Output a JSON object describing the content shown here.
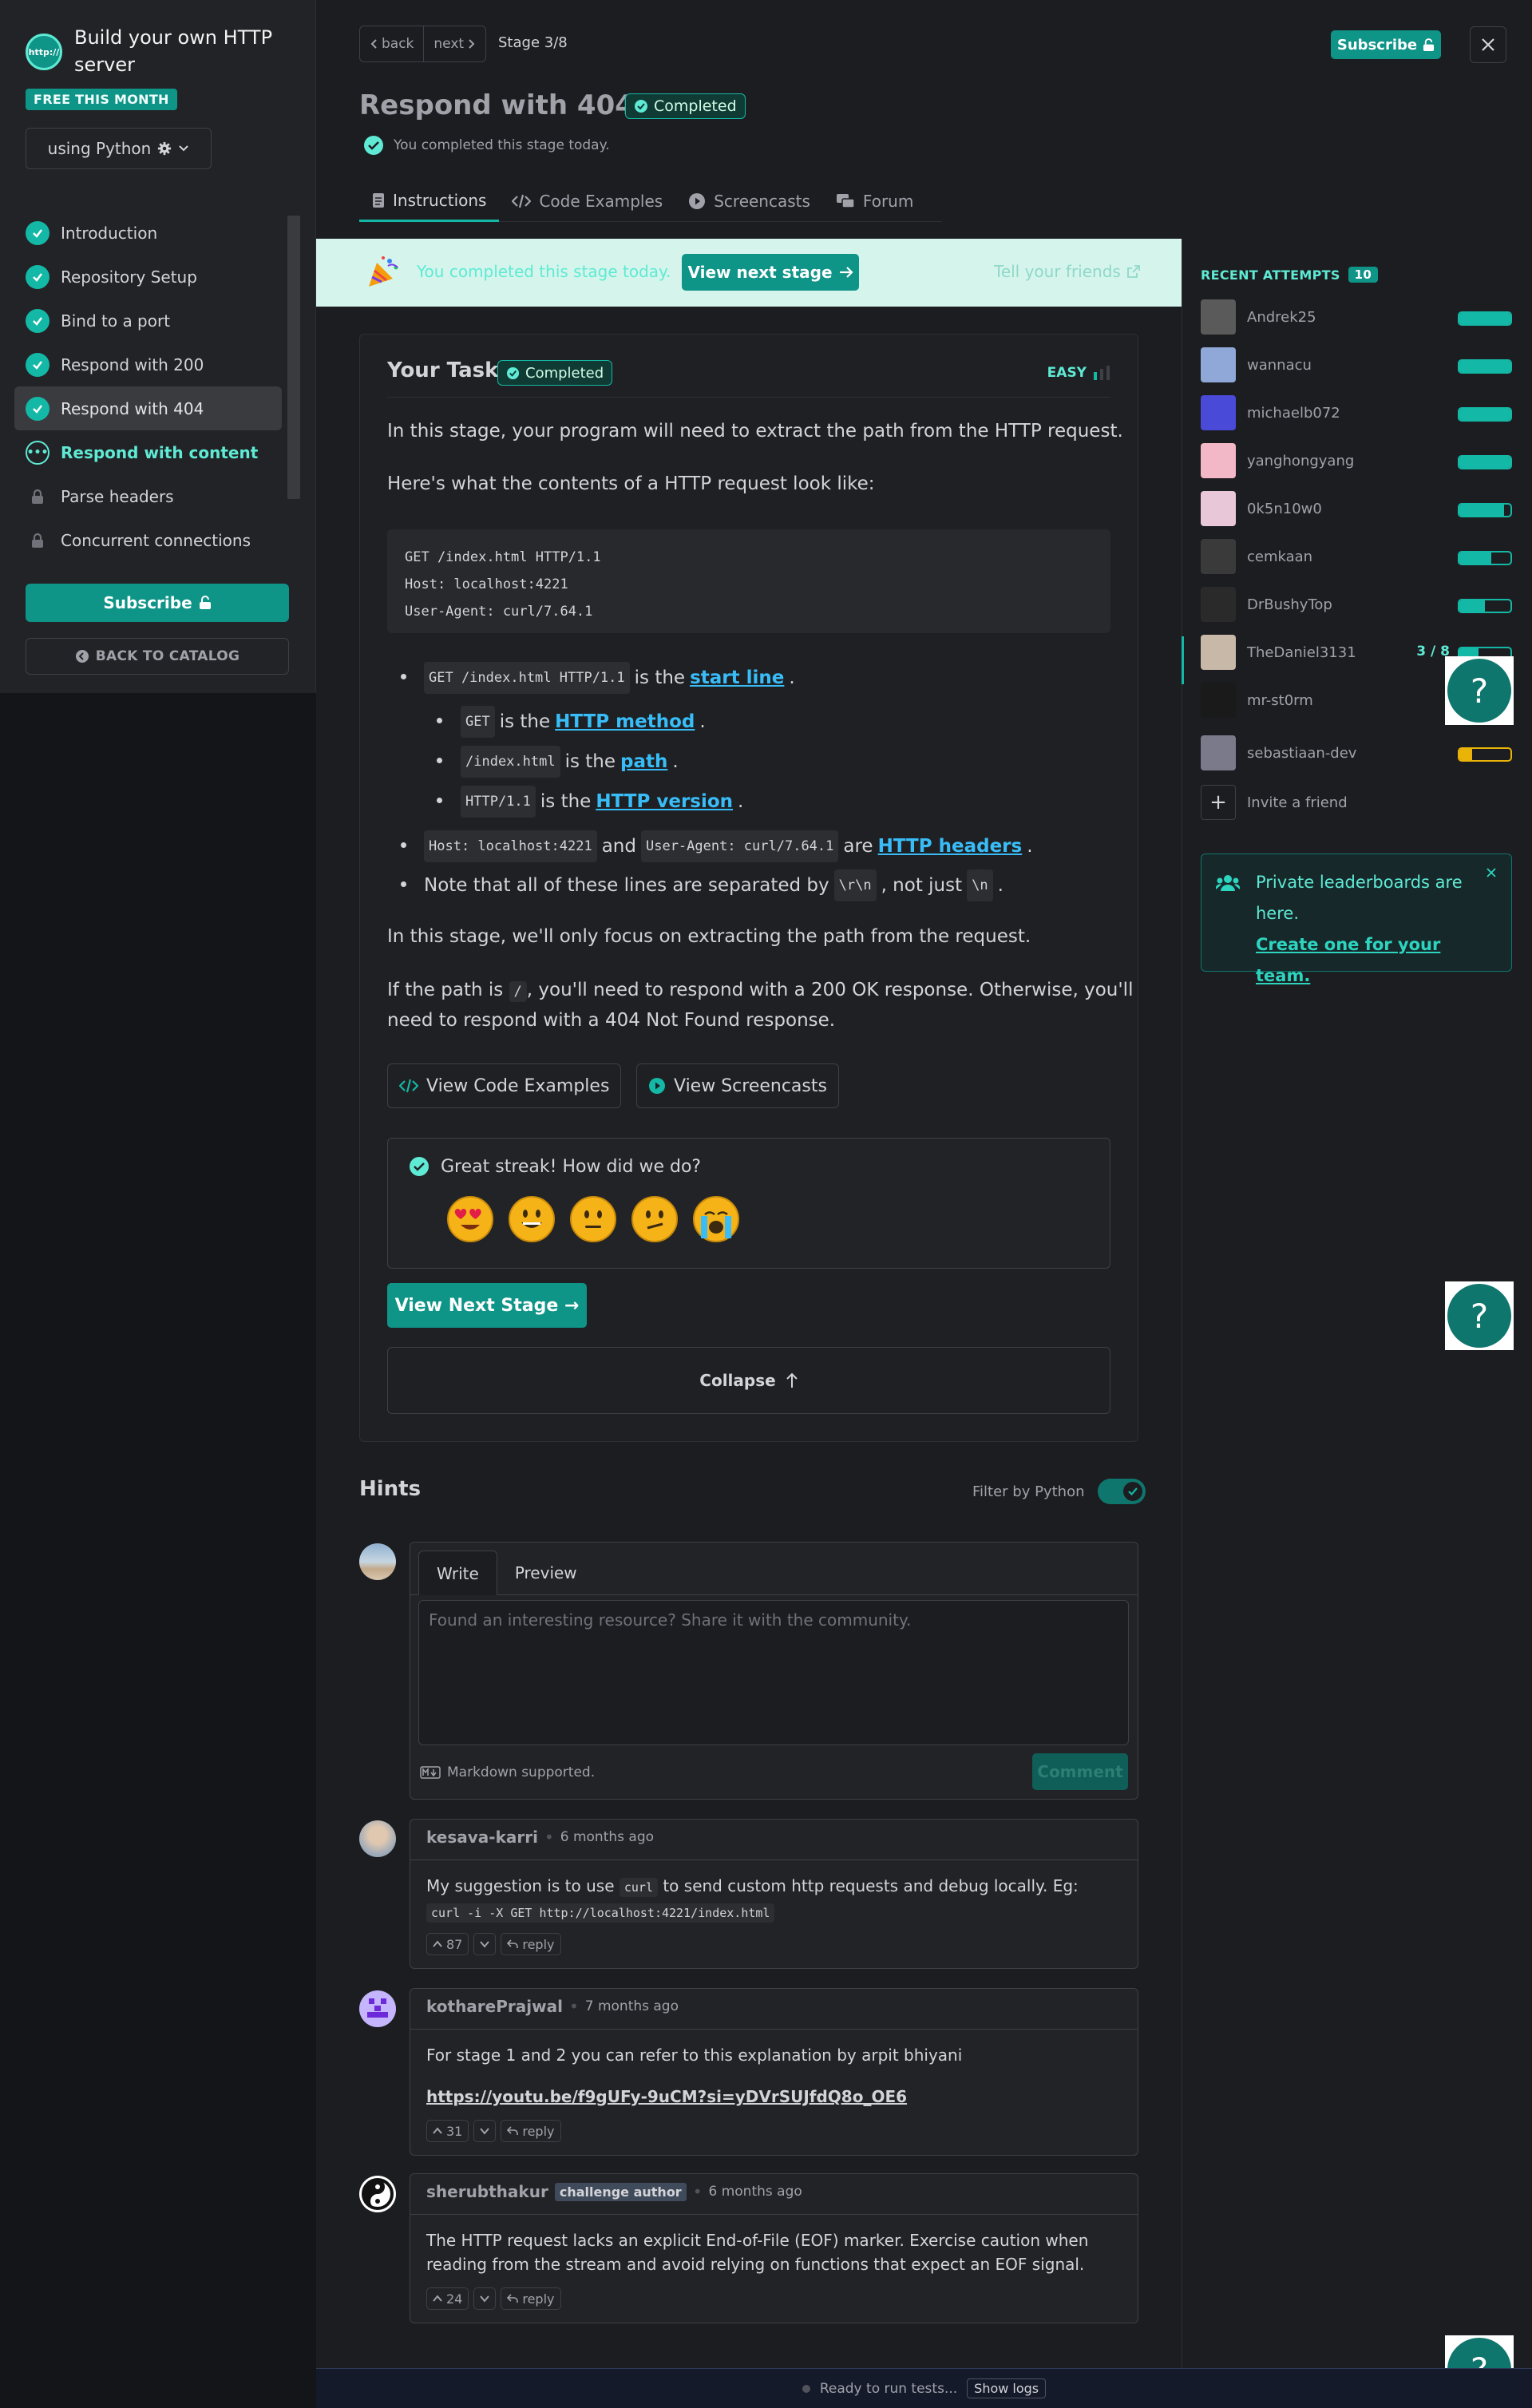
{
  "course": {
    "title": "Build your own HTTP server",
    "logo_text": "http://",
    "free_badge": "FREE THIS MONTH",
    "language_label": "using Python"
  },
  "stages": [
    {
      "label": "Introduction",
      "status": "done"
    },
    {
      "label": "Repository Setup",
      "status": "done"
    },
    {
      "label": "Bind to a port",
      "status": "done"
    },
    {
      "label": "Respond with 200",
      "status": "done"
    },
    {
      "label": "Respond with 404",
      "status": "done"
    },
    {
      "label": "Respond with content",
      "status": "current"
    },
    {
      "label": "Parse headers",
      "status": "locked"
    },
    {
      "label": "Concurrent connections",
      "status": "locked"
    }
  ],
  "sidebar": {
    "subscribe_label": "Subscribe",
    "back_label": "BACK TO CATALOG"
  },
  "header": {
    "back_label": "back",
    "next_label": "next",
    "stage_progress": "Stage 3/8",
    "subscribe_label": "Subscribe",
    "title": "Respond with 404",
    "badge": "Completed",
    "completed_note": "You completed this stage today."
  },
  "tabs": [
    {
      "label": "Instructions",
      "icon": "document-icon"
    },
    {
      "label": "Code Examples",
      "icon": "code-icon"
    },
    {
      "label": "Screencasts",
      "icon": "play-icon"
    },
    {
      "label": "Forum",
      "icon": "chat-icon"
    }
  ],
  "banner": {
    "text": "You completed this stage today.",
    "button": "View next stage",
    "tell": "Tell your friends"
  },
  "task": {
    "heading": "Your Task",
    "badge": "Completed",
    "difficulty": "EASY",
    "p1": "In this stage, your program will need to extract the path from the HTTP request.",
    "p2": "Here's what the contents of a HTTP request look like:",
    "code": "GET /index.html HTTP/1.1\nHost: localhost:4221\nUser-Agent: curl/7.64.1",
    "b1_code": "GET /index.html HTTP/1.1",
    "b1_text": "is the",
    "b1_link": "start line",
    "b1a_code": "GET",
    "b1a_text": "is the",
    "b1a_link": "HTTP method",
    "b1b_code": "/index.html",
    "b1b_text": "is the",
    "b1b_link": "path",
    "b1c_code": "HTTP/1.1",
    "b1c_text": "is the",
    "b1c_link": "HTTP version",
    "b2_code1": "Host: localhost:4221",
    "b2_and": "and",
    "b2_code2": "User-Agent: curl/7.64.1",
    "b2_are": "are",
    "b2_link": "HTTP headers",
    "b3_text1": "Note that all of these lines are separated by",
    "b3_code1": "\\r\\n",
    "b3_text2": ", not just",
    "b3_code2": "\\n",
    "p3": "In this stage, we'll only focus on extracting the path from the request.",
    "p4a": "If the path is",
    "p4_code": "/",
    "p4b": ", you'll need to respond with a 200 OK response. Otherwise, you'll",
    "p4c": "need to respond with a 404 Not Found response.",
    "code_examples_btn": "View Code Examples",
    "screencasts_btn": "View Screencasts",
    "feedback_q": "Great streak! How did we do?",
    "next_stage_btn": "View Next Stage →",
    "collapse_btn": "Collapse"
  },
  "recent_attempts": {
    "title": "RECENT ATTEMPTS",
    "count": "10",
    "users": [
      {
        "name": "Andrek25",
        "progress": 1.0,
        "color": "#5a5a5a"
      },
      {
        "name": "wannacu",
        "progress": 1.0,
        "color": "#8fa8d8"
      },
      {
        "name": "michaelb072",
        "progress": 1.0,
        "color": "#4a4ad8"
      },
      {
        "name": "yanghongyang",
        "progress": 1.0,
        "color": "#f2b8c8"
      },
      {
        "name": "0k5n10w0",
        "progress": 0.88,
        "color": "#e8c8d8"
      },
      {
        "name": "cemkaan",
        "progress": 0.62,
        "color": "#3a3a3a"
      },
      {
        "name": "DrBushyTop",
        "progress": 0.5,
        "color": "#2a2a2a"
      },
      {
        "name": "TheDaniel3131",
        "progress": 0.375,
        "color": "#c8b8a8",
        "label": "3 / 8"
      },
      {
        "name": "mr-st0rm",
        "progress": 0.0,
        "color": "#1a1a1a"
      },
      {
        "name": "sebastiaan-dev",
        "progress": 0.25,
        "color": "#7a7a8a"
      }
    ],
    "invite": "Invite a friend"
  },
  "promo": {
    "text": "Private leaderboards are here.",
    "link": "Create one for your team."
  },
  "hints": {
    "heading": "Hints",
    "filter_label": "Filter by Python",
    "write_tab": "Write",
    "preview_tab": "Preview",
    "placeholder": "Found an interesting resource? Share it with the community.",
    "markdown_note": "Markdown supported.",
    "comment_btn": "Comment"
  },
  "comments": [
    {
      "user": "kesava-karri",
      "time": "6 months ago",
      "text1": "My suggestion is to use",
      "code1": "curl",
      "text2": "to send custom http requests and debug locally. Eg:",
      "code2": "curl -i -X GET http://localhost:4221/index.html",
      "votes": "87",
      "reply": "reply"
    },
    {
      "user": "kotharePrajwal",
      "time": "7 months ago",
      "text1": "For stage 1 and 2 you can refer to this explanation by arpit bhiyani",
      "link": "https://youtu.be/f9gUFy-9uCM?si=yDVrSUJfdQ8o_OE6",
      "votes": "31",
      "reply": "reply"
    },
    {
      "user": "sherubthakur",
      "badge": "challenge author",
      "time": "6 months ago",
      "text1": "The HTTP request lacks an explicit End-of-File (EOF) marker. Exercise caution when",
      "text2": "reading from the stream and avoid relying on functions that expect an EOF signal.",
      "votes": "24",
      "reply": "reply"
    }
  ],
  "status_bar": {
    "text": "Ready to run tests...",
    "show_logs": "Show logs"
  },
  "colors": {
    "accent": "#0f9488",
    "accent_light": "#5eead4",
    "link": "#38bdf8",
    "background": "#1c1d20"
  },
  "help_label": "?"
}
